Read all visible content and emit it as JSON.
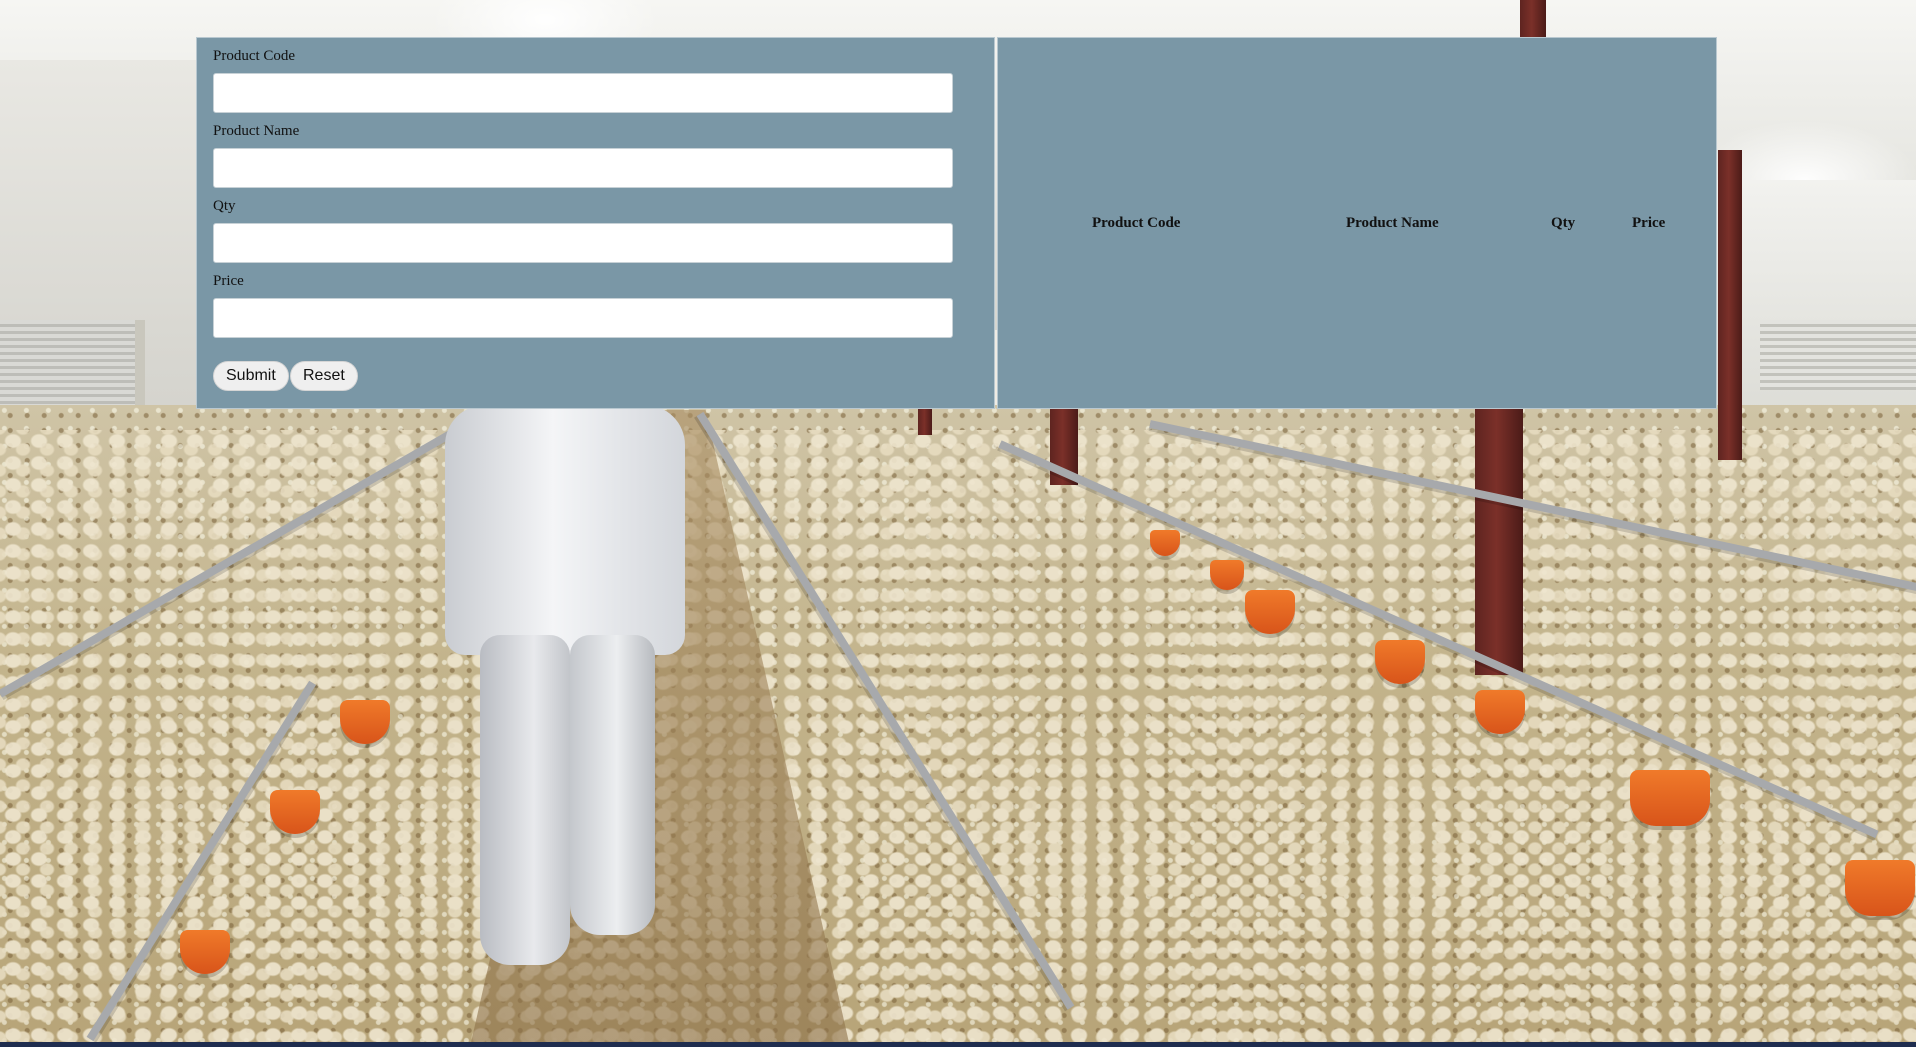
{
  "form": {
    "fields": [
      {
        "label": "Product Code",
        "value": "",
        "placeholder": ""
      },
      {
        "label": "Product Name",
        "value": "",
        "placeholder": ""
      },
      {
        "label": "Qty",
        "value": "",
        "placeholder": ""
      },
      {
        "label": "Price",
        "value": "",
        "placeholder": ""
      }
    ],
    "submit_label": "Submit",
    "reset_label": "Reset"
  },
  "table": {
    "headers": [
      "Product Code",
      "Product Name",
      "Qty",
      "Price"
    ],
    "rows": []
  },
  "colors": {
    "panel_bg": "#7a97a6",
    "panel_border": "#b9c8d0",
    "input_bg": "#ffffff",
    "button_bg": "#efefef"
  },
  "background": {
    "icon": "poultry-barn-photo"
  }
}
